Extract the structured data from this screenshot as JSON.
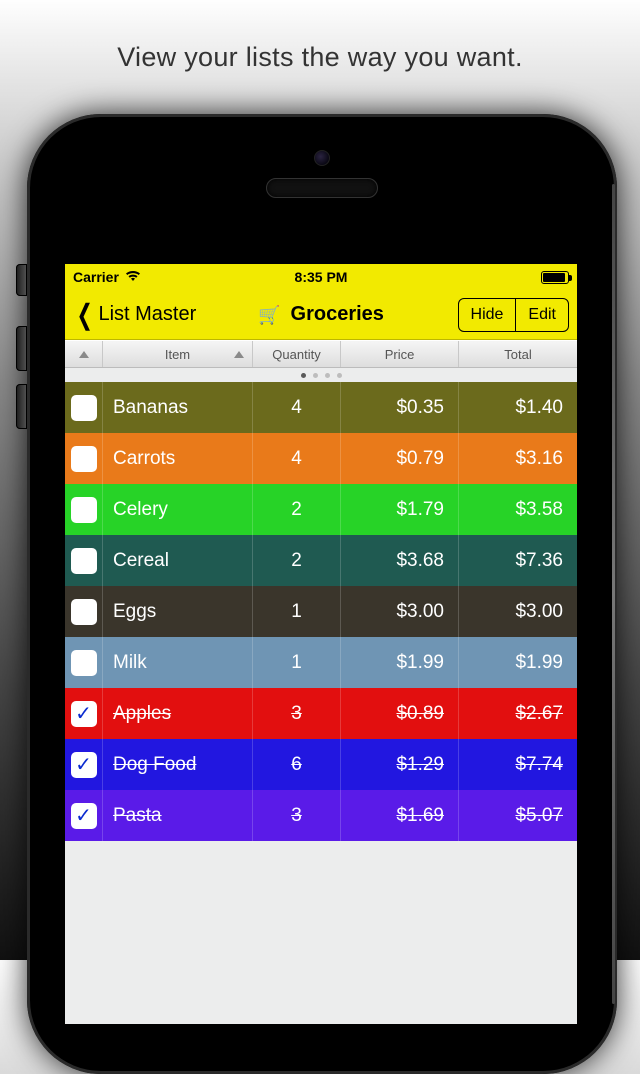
{
  "promo_text": "View your lists the way you want.",
  "status": {
    "carrier": "Carrier",
    "time": "8:35 PM"
  },
  "nav": {
    "back_label": "List Master",
    "title": "Groceries",
    "hide_label": "Hide",
    "edit_label": "Edit"
  },
  "columns": {
    "item": "Item",
    "qty": "Quantity",
    "price": "Price",
    "total": "Total"
  },
  "pager": {
    "count": 4,
    "active": 0
  },
  "rows": [
    {
      "checked": false,
      "item": "Bananas",
      "qty": "4",
      "price": "$0.35",
      "total": "$1.40",
      "bg": "#6b6a1c"
    },
    {
      "checked": false,
      "item": "Carrots",
      "qty": "4",
      "price": "$0.79",
      "total": "$3.16",
      "bg": "#e97a1a"
    },
    {
      "checked": false,
      "item": "Celery",
      "qty": "2",
      "price": "$1.79",
      "total": "$3.58",
      "bg": "#27d327"
    },
    {
      "checked": false,
      "item": "Cereal",
      "qty": "2",
      "price": "$3.68",
      "total": "$7.36",
      "bg": "#1f5a51"
    },
    {
      "checked": false,
      "item": "Eggs",
      "qty": "1",
      "price": "$3.00",
      "total": "$3.00",
      "bg": "#3a352b"
    },
    {
      "checked": false,
      "item": "Milk",
      "qty": "1",
      "price": "$1.99",
      "total": "$1.99",
      "bg": "#6f95b4"
    },
    {
      "checked": true,
      "item": "Apples",
      "qty": "3",
      "price": "$0.89",
      "total": "$2.67",
      "bg": "#e20f0f"
    },
    {
      "checked": true,
      "item": "Dog Food",
      "qty": "6",
      "price": "$1.29",
      "total": "$7.74",
      "bg": "#2217e0"
    },
    {
      "checked": true,
      "item": "Pasta",
      "qty": "3",
      "price": "$1.69",
      "total": "$5.07",
      "bg": "#5a1be8"
    }
  ]
}
